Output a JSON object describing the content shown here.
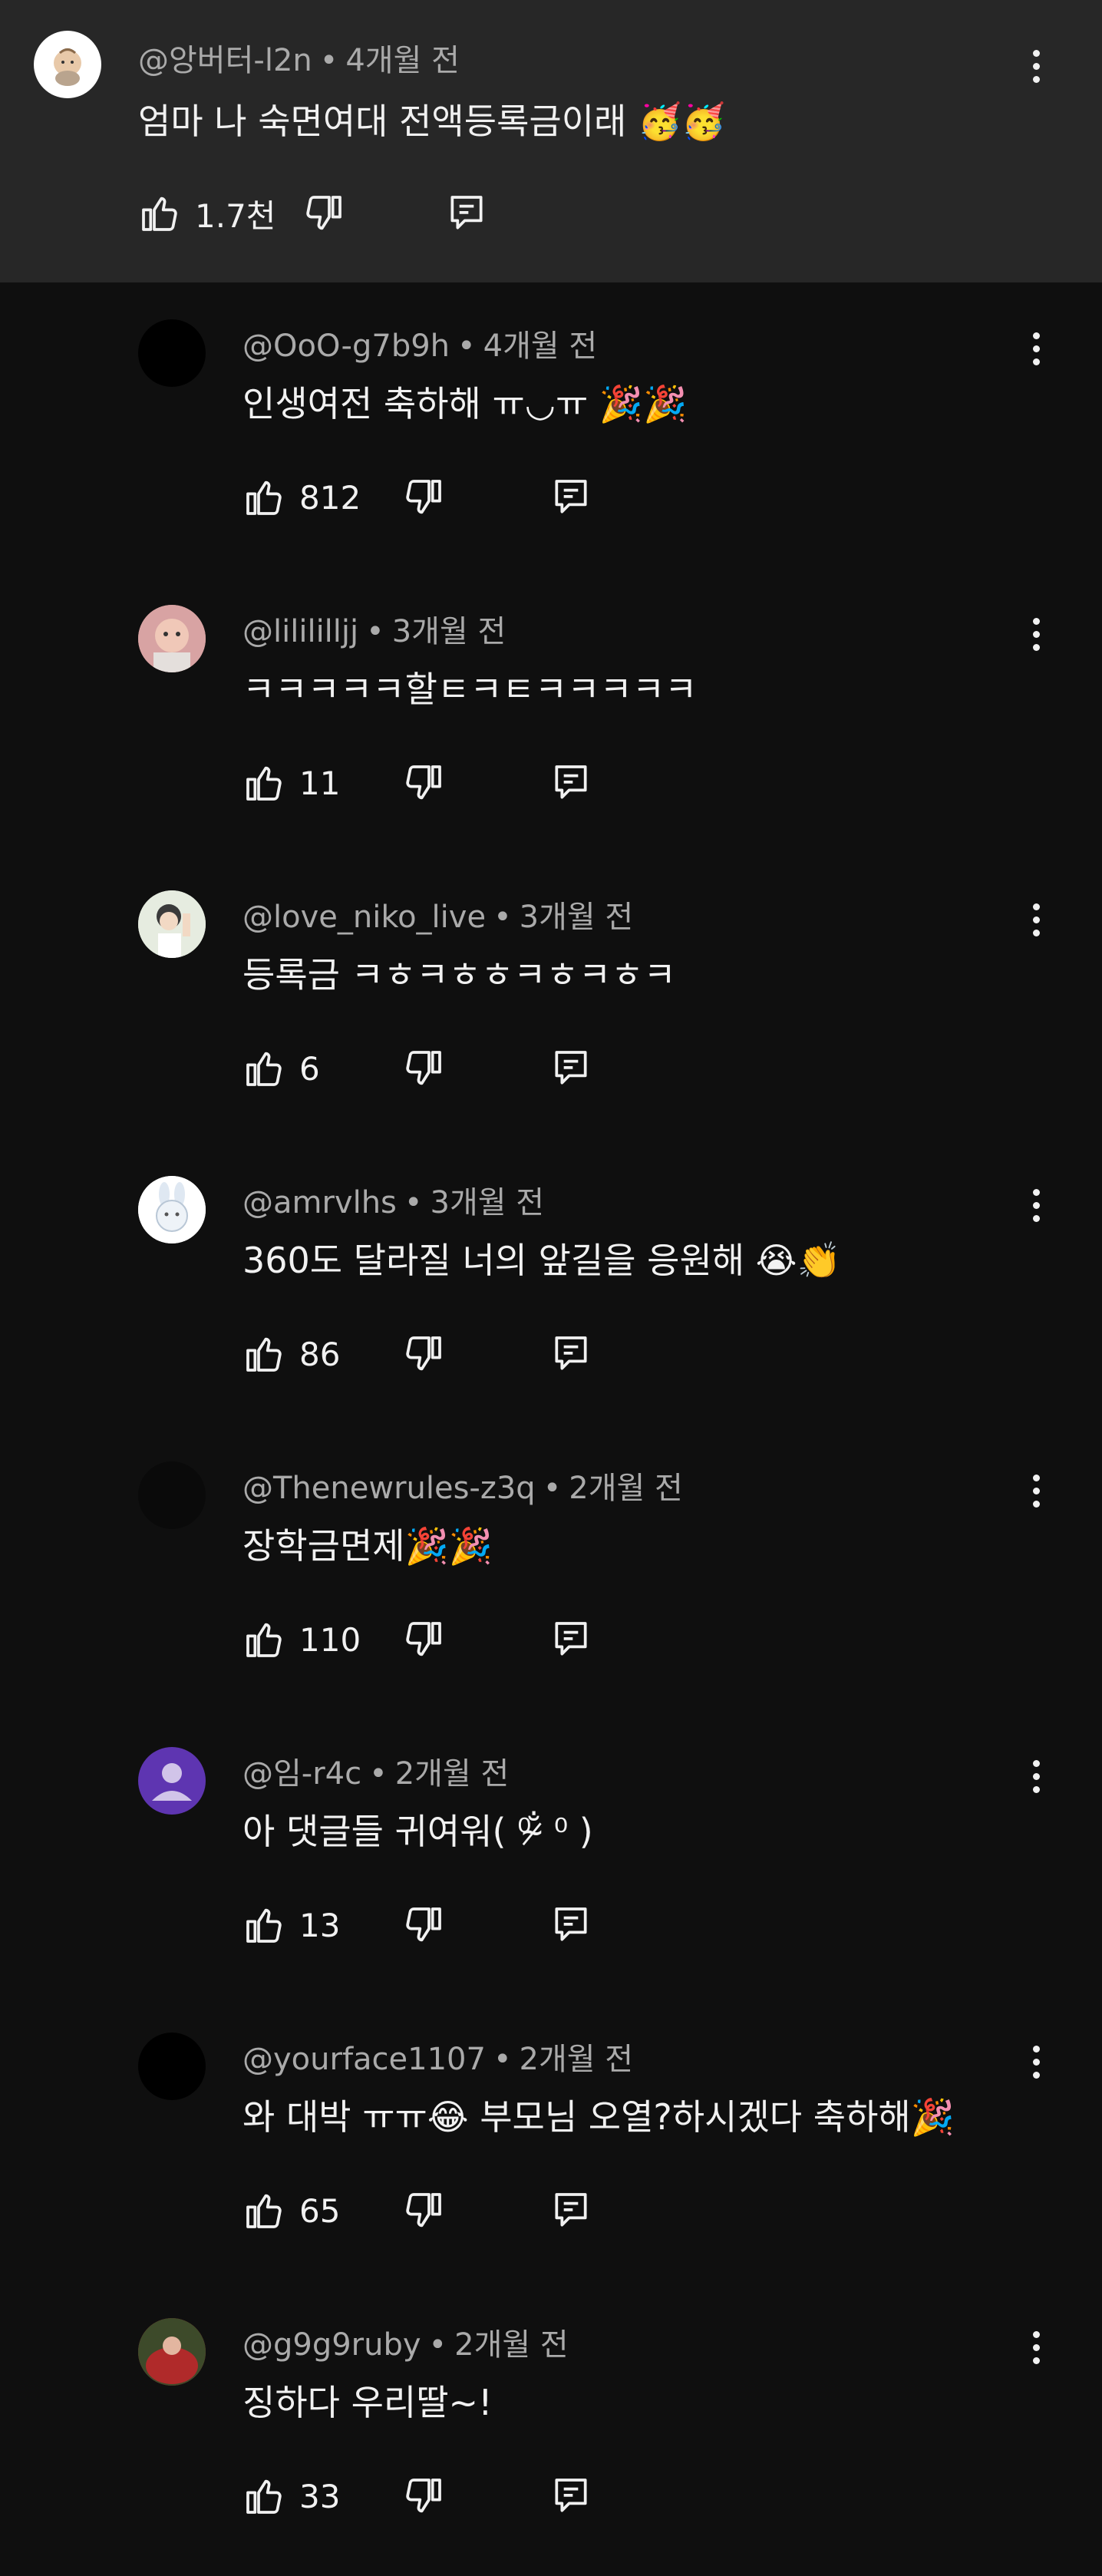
{
  "parent": {
    "handle": "@앙버터-l2n",
    "time": "4개월 전",
    "text": "엄마 나 숙면여대 전액등록금이래 🥳🥳",
    "likes": "1.7천",
    "avatar_icon": "baby-avatar-icon"
  },
  "separator": "•",
  "replies": [
    {
      "handle": "@OoO-g7b9h",
      "time": "4개월 전",
      "text": "인생여전 축하해 ㅠ◡ㅠ 🎉🎉",
      "likes": "812",
      "avatar_color": "#000000"
    },
    {
      "handle": "@lilililljj",
      "time": "3개월 전",
      "text": "ㅋㅋㅋㅋㅋ할ㅌㅋㅌㅋㅋㅋㅋㅋ",
      "likes": "11",
      "avatar_color": "#c98b8b"
    },
    {
      "handle": "@love_niko_live",
      "time": "3개월 전",
      "text": "등록금 ㅋㅎㅋㅎㅎㅋㅎㅋㅎㅋ",
      "likes": "6",
      "avatar_color": "#cfd8c8"
    },
    {
      "handle": "@amrvlhs",
      "time": "3개월 전",
      "text": "360도 달라질 너의 앞길을 응원해 😭👏",
      "likes": "86",
      "avatar_color": "#ffffff"
    },
    {
      "handle": "@Thenewrules-z3q",
      "time": "2개월 전",
      "text": "장학금면제🎉🎉",
      "likes": "110",
      "avatar_color": "#0a0a0a"
    },
    {
      "handle": "@임-r4c",
      "time": "2개월 전",
      "text": "아 댓글들 귀여워( ⁰ ̷̴̐ ⁰ )",
      "likes": "13",
      "avatar_color": "#5e35b1"
    },
    {
      "handle": "@yourface1107",
      "time": "2개월 전",
      "text": "와 대박 ㅠㅠ😂 부모님 오열?하시겠다 축하해🎉",
      "likes": "65",
      "avatar_color": "#000000"
    },
    {
      "handle": "@g9g9ruby",
      "time": "2개월 전",
      "text": "징하다 우리딸~!",
      "likes": "33",
      "avatar_color": "#b02a2a"
    }
  ]
}
